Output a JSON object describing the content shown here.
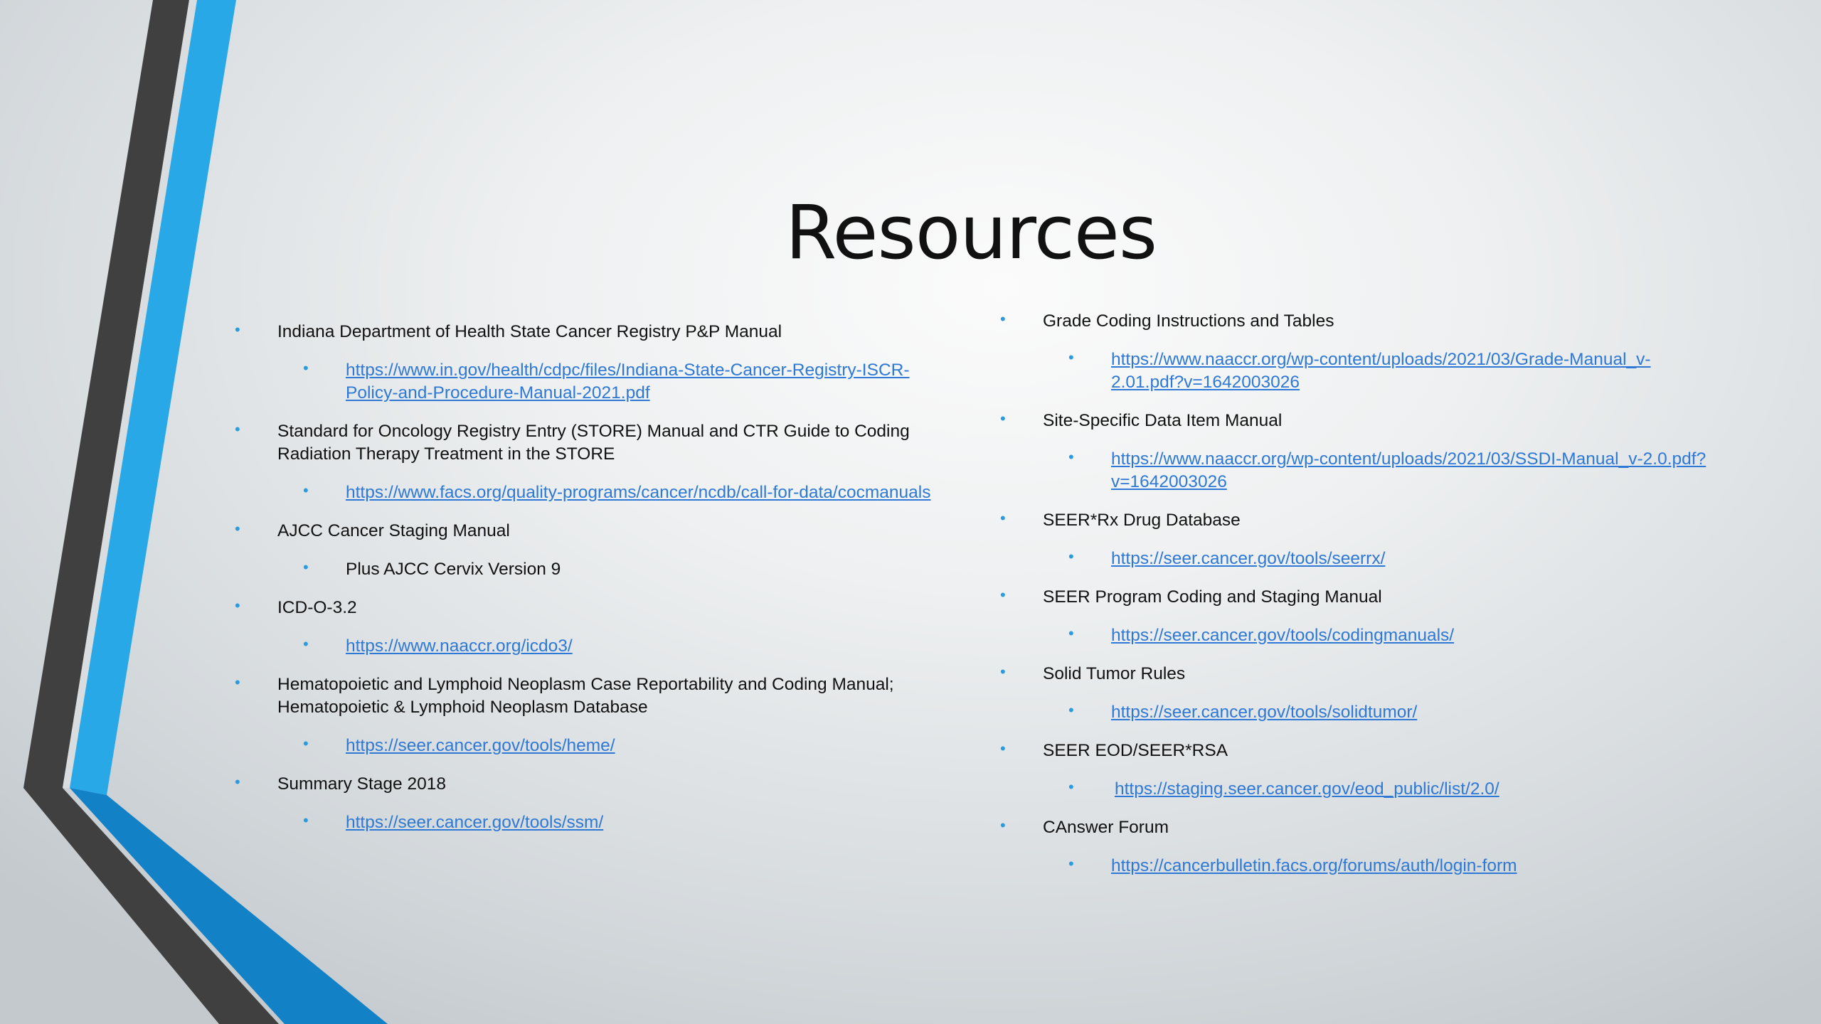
{
  "title": "Resources",
  "accent_colors": {
    "blue": "#29a8e8",
    "dark_blue": "#1281c6",
    "dark_gray": "#404040",
    "link": "#2e78d6"
  },
  "left_column": [
    {
      "label": "Indiana Department of Health State Cancer Registry P&P Manual",
      "sub": {
        "text": "https://www.in.gov/health/cdpc/files/Indiana-State-Cancer-Registry-ISCR-Policy-and-Procedure-Manual-2021.pdf",
        "is_link": true
      }
    },
    {
      "label": "Standard for Oncology Registry Entry (STORE) Manual and CTR Guide to Coding Radiation Therapy Treatment in the STORE",
      "sub": {
        "text": "https://www.facs.org/quality-programs/cancer/ncdb/call-for-data/cocmanuals",
        "is_link": true
      }
    },
    {
      "label": "AJCC Cancer Staging Manual",
      "sub": {
        "text": "Plus AJCC Cervix Version 9",
        "is_link": false
      }
    },
    {
      "label": "ICD-O-3.2",
      "sub": {
        "text": "https://www.naaccr.org/icdo3/",
        "is_link": true
      }
    },
    {
      "label": "Hematopoietic and Lymphoid Neoplasm Case Reportability and Coding Manual; Hematopoietic & Lymphoid Neoplasm Database",
      "sub": {
        "text": "https://seer.cancer.gov/tools/heme/",
        "is_link": true
      }
    },
    {
      "label": "Summary Stage 2018",
      "sub": {
        "text": "https://seer.cancer.gov/tools/ssm/",
        "is_link": true
      }
    }
  ],
  "right_column": [
    {
      "label": "Grade Coding Instructions and Tables",
      "sub": {
        "text": "https://www.naaccr.org/wp-content/uploads/2021/03/Grade-Manual_v-2.01.pdf?v=1642003026",
        "is_link": true
      }
    },
    {
      "label": "Site-Specific Data Item Manual",
      "sub": {
        "text": "https://www.naaccr.org/wp-content/uploads/2021/03/SSDI-Manual_v-2.0.pdf?v=1642003026",
        "is_link": true
      }
    },
    {
      "label": "SEER*Rx Drug Database",
      "sub": {
        "text": "https://seer.cancer.gov/tools/seerrx/",
        "is_link": true
      }
    },
    {
      "label": "SEER Program Coding and Staging Manual",
      "sub": {
        "text": "https://seer.cancer.gov/tools/codingmanuals/",
        "is_link": true
      }
    },
    {
      "label": "Solid Tumor Rules",
      "sub": {
        "text": "https://seer.cancer.gov/tools/solidtumor/",
        "is_link": true
      }
    },
    {
      "label": "SEER EOD/SEER*RSA",
      "sub": {
        "text": "https://staging.seer.cancer.gov/eod_public/list/2.0/",
        "is_link": true
      }
    },
    {
      "label": "CAnswer Forum",
      "sub": {
        "text": "https://cancerbulletin.facs.org/forums/auth/login-form",
        "is_link": true
      }
    }
  ]
}
